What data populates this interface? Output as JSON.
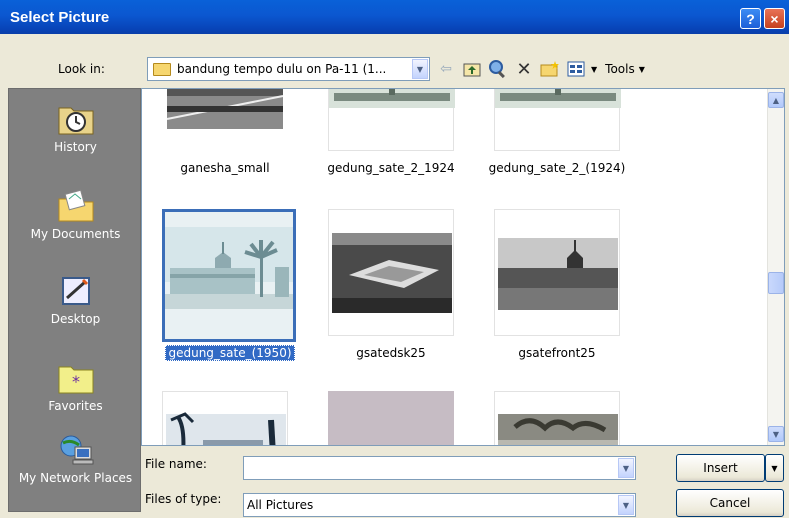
{
  "window": {
    "title": "Select Picture",
    "help_label": "?",
    "close_label": "×"
  },
  "lookin": {
    "label": "Look in:",
    "value": "bandung tempo dulu on Pa-11 (1..."
  },
  "toolbar": {
    "tools_label": "Tools"
  },
  "places": [
    {
      "label": "History"
    },
    {
      "label": "My Documents"
    },
    {
      "label": "Desktop"
    },
    {
      "label": "Favorites"
    },
    {
      "label": "My Network Places"
    }
  ],
  "files": [
    {
      "name": "ganesha_small"
    },
    {
      "name": "gedung_sate_2_1924"
    },
    {
      "name": "gedung_sate_2_(1924)"
    },
    {
      "name": "gedung_sate_(1950)",
      "selected": true
    },
    {
      "name": "gsatedsk25"
    },
    {
      "name": "gsatefront25"
    }
  ],
  "filename": {
    "label": "File name:",
    "value": ""
  },
  "filetype": {
    "label": "Files of type:",
    "value": "All Pictures"
  },
  "buttons": {
    "insert": "Insert",
    "cancel": "Cancel"
  },
  "colors": {
    "titlebar": "#0a58d0",
    "selection": "#316ac5",
    "places_bg": "#808080"
  }
}
